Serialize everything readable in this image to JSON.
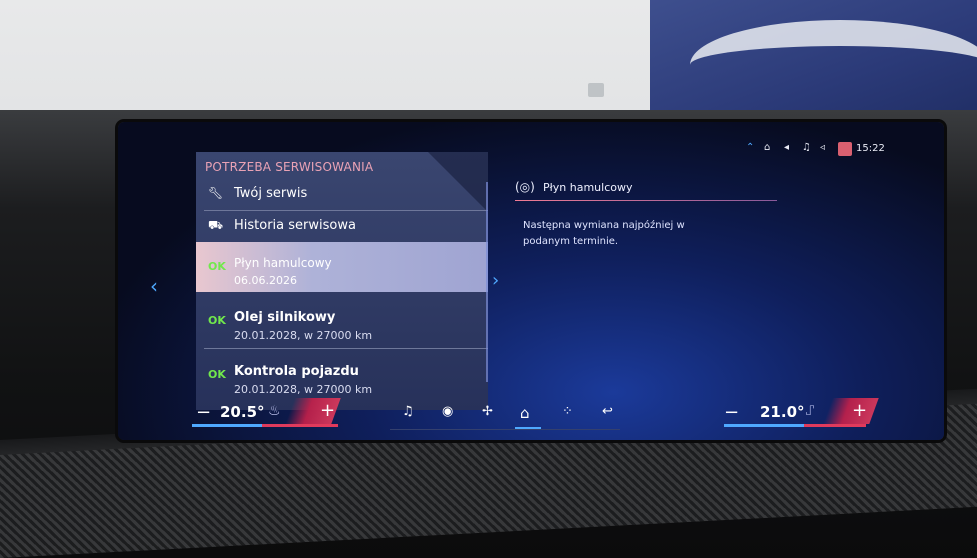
{
  "status_bar": {
    "icons": [
      "connectivity-icon",
      "wifi-icon",
      "volume-icon",
      "music-icon",
      "speaker-icon",
      "profile-icon"
    ],
    "time": "15:22"
  },
  "service_panel": {
    "title": "POTRZEBA SERWISOWANIA",
    "items": [
      {
        "icon": "wrench-icon",
        "label": "Twój serwis"
      },
      {
        "icon": "car-history-icon",
        "label": "Historia serwisowa"
      }
    ],
    "entries": [
      {
        "status": "OK",
        "label": "Płyn hamulcowy",
        "detail": "06.06.2026",
        "selected": true
      },
      {
        "status": "OK",
        "label": "Olej silnikowy",
        "detail": "20.01.2028, w 27000 km",
        "selected": false
      },
      {
        "status": "OK",
        "label": "Kontrola pojazdu",
        "detail": "20.01.2028, w 27000 km",
        "selected": false
      }
    ]
  },
  "detail": {
    "title": "Płyn hamulcowy",
    "text": "Następna wymiana najpóźniej w podanym terminie."
  },
  "climate": {
    "left_temp": "20.5°",
    "right_temp": "21.0°",
    "minus": "−",
    "plus": "+"
  },
  "dock": {
    "icons": [
      "music-icon",
      "navigation-icon",
      "fan-icon",
      "home-icon",
      "apps-icon",
      "phone-icon"
    ]
  },
  "colors": {
    "ok_green": "#71e84c",
    "accent_blue": "#4fa9ff",
    "accent_red": "#e03a5c",
    "title_pink": "#e9a2b5"
  }
}
